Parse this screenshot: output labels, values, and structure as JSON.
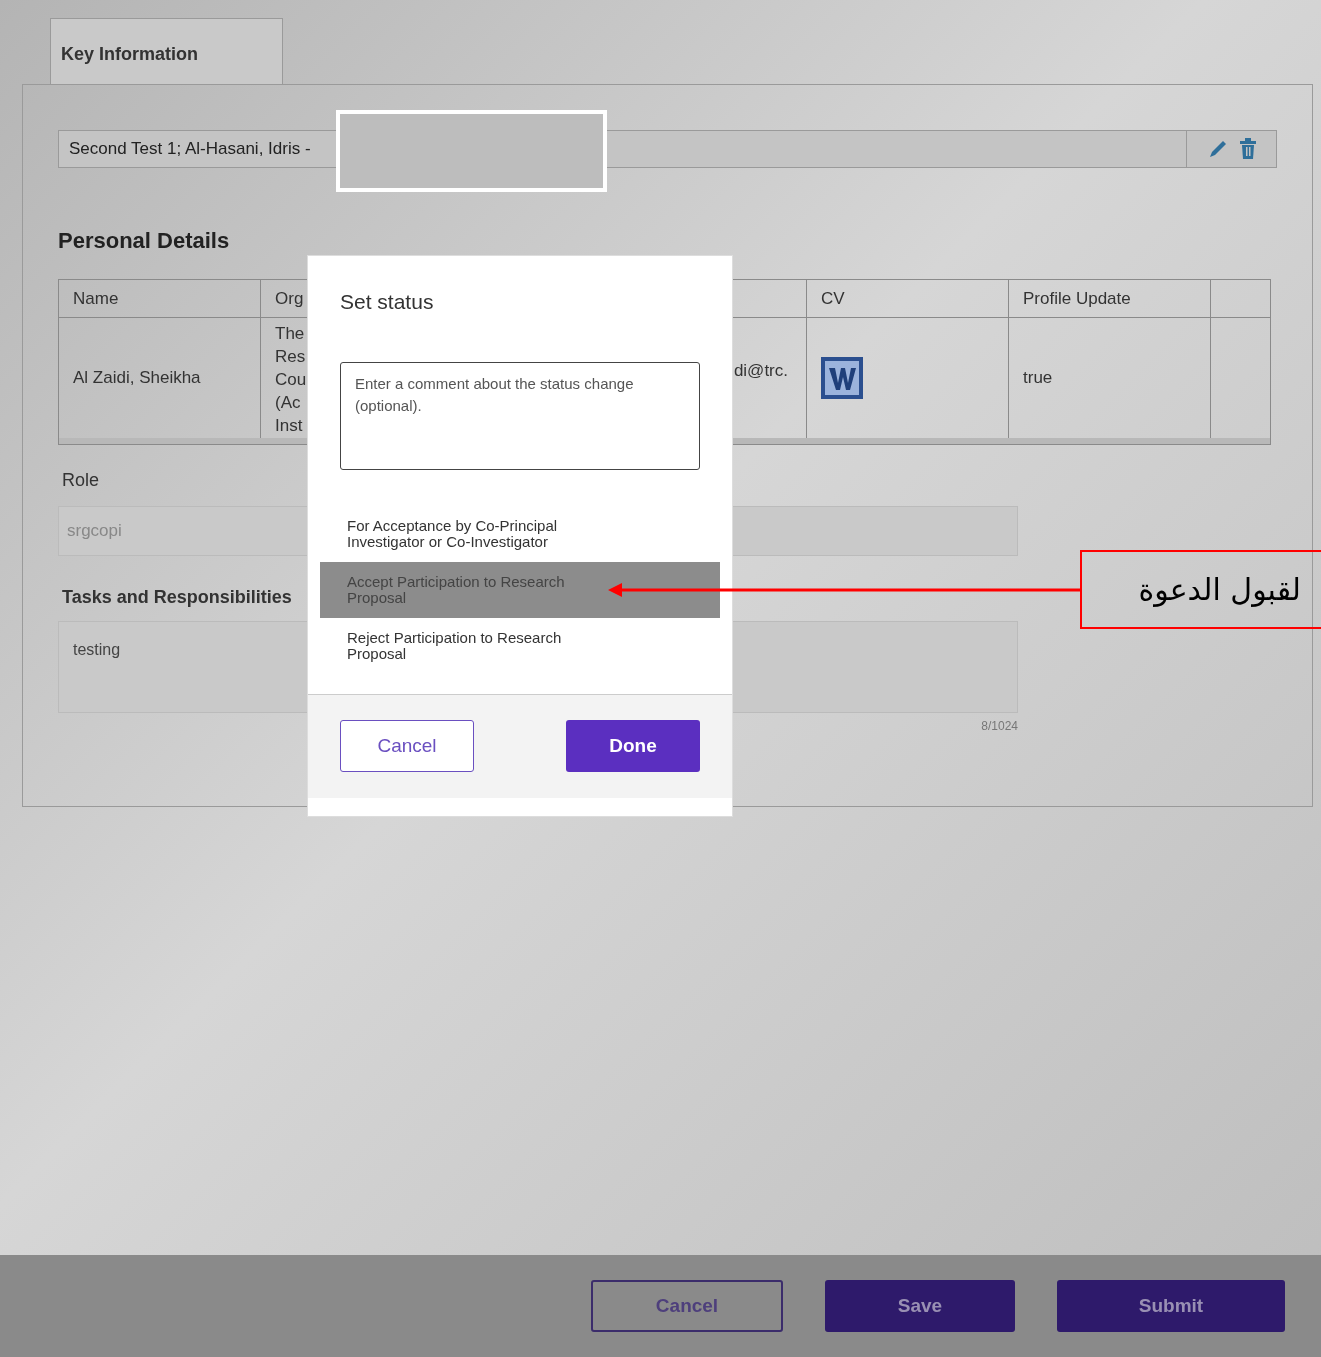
{
  "tabs": [
    {
      "label": "Key Information",
      "selected": true
    }
  ],
  "summary": {
    "value": "Second Test 1; Al-Hasani, Idris -"
  },
  "personal_details": {
    "heading": "Personal Details",
    "columns": [
      "Name",
      "Org",
      "CV",
      "Profile Update"
    ],
    "rows": [
      {
        "name": "Al Zaidi, Sheikha",
        "org": [
          "The",
          "Res",
          "Cou",
          "(Ac",
          "Inst"
        ],
        "email": "di@trc.",
        "profile_update": "true"
      }
    ]
  },
  "role": {
    "label": "Role",
    "value": "srgcopi"
  },
  "tasks": {
    "label": "Tasks and Responsibilities",
    "value": "testing",
    "counter": "8/1024"
  },
  "modal": {
    "title": "Set status",
    "comment": {
      "placeholder": "Enter a comment about the status change (optional)."
    },
    "options": [
      {
        "label": "For Acceptance by Co-Principal Investigator or Co-Investigator",
        "selected": false
      },
      {
        "label": "Accept Participation to Research Proposal",
        "selected": true
      },
      {
        "label": "Reject Participation to Research Proposal",
        "selected": false
      }
    ],
    "buttons": [
      "Cancel",
      "Done"
    ]
  },
  "footer_buttons": [
    "Cancel",
    "Save",
    "Submit"
  ],
  "annotation": {
    "text": "لقبول الدعوة"
  }
}
